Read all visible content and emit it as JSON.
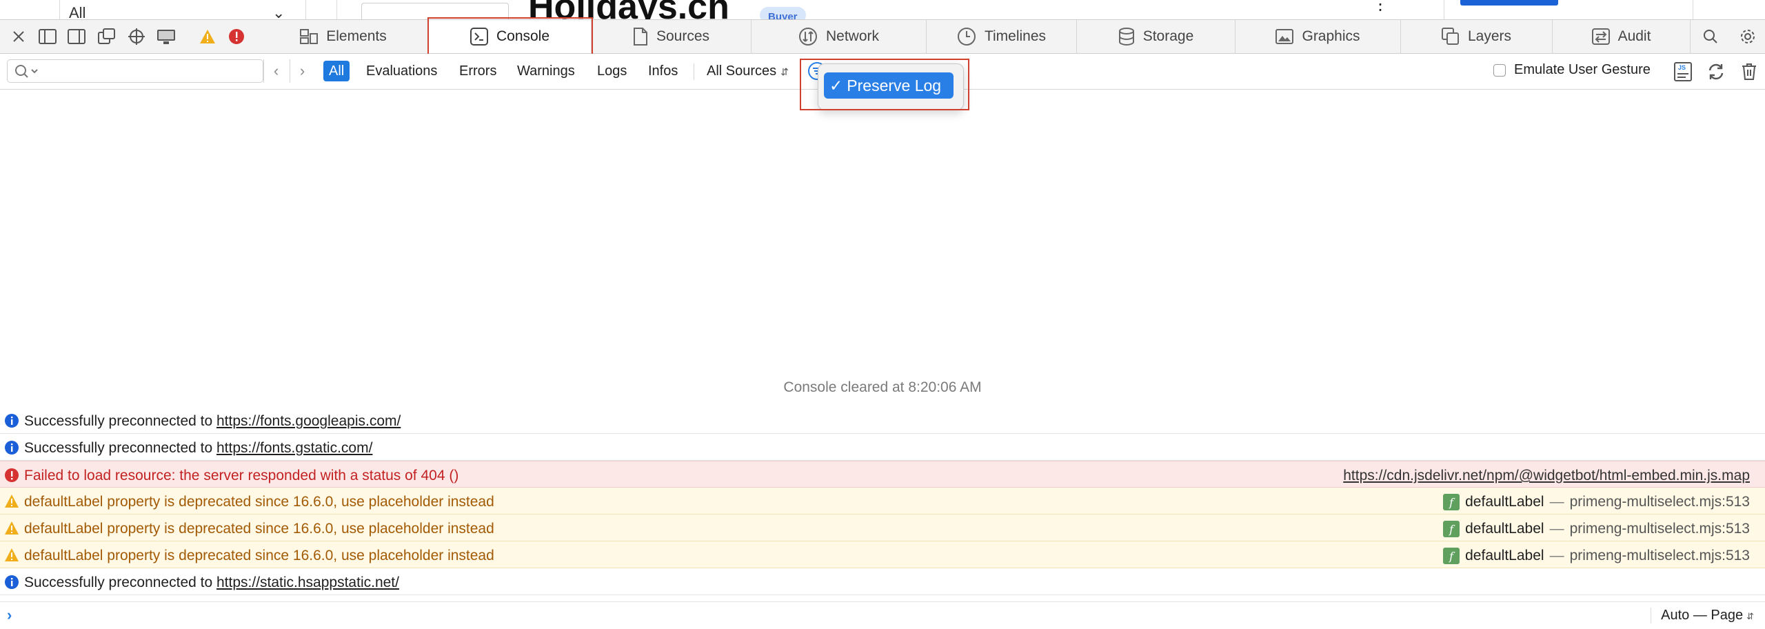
{
  "page": {
    "all_filter": "All",
    "title": "Holidays.ch",
    "badge": "Buyer"
  },
  "toolbar": {
    "tabs": [
      {
        "label": "Elements",
        "icon": "elements-icon"
      },
      {
        "label": "Console",
        "icon": "console-icon",
        "active": true
      },
      {
        "label": "Sources",
        "icon": "sources-icon"
      },
      {
        "label": "Network",
        "icon": "network-icon"
      },
      {
        "label": "Timelines",
        "icon": "timelines-icon"
      },
      {
        "label": "Storage",
        "icon": "storage-icon"
      },
      {
        "label": "Graphics",
        "icon": "graphics-icon"
      },
      {
        "label": "Layers",
        "icon": "layers-icon"
      },
      {
        "label": "Audit",
        "icon": "audit-icon"
      }
    ]
  },
  "filterbar": {
    "search_placeholder": "",
    "levels": [
      "All",
      "Evaluations",
      "Errors",
      "Warnings",
      "Logs",
      "Infos"
    ],
    "active_level": "All",
    "sources": "All Sources",
    "emulate_label": "Emulate User Gesture",
    "emulate_checked": false
  },
  "popup": {
    "option": "Preserve Log",
    "checked": true
  },
  "console": {
    "cleared": "Console cleared at 8:20:06 AM",
    "messages": [
      {
        "level": "info",
        "text": "Successfully preconnected to ",
        "link": "https://fonts.googleapis.com/"
      },
      {
        "level": "info",
        "text": "Successfully preconnected to ",
        "link": "https://fonts.gstatic.com/"
      },
      {
        "level": "error",
        "text": "Failed to load resource: the server responded with a status of 404 ()",
        "source": "https://cdn.jsdelivr.net/npm/@widgetbot/html-embed.min.js.map"
      },
      {
        "level": "warning",
        "text": "defaultLabel property is deprecated since 16.6.0, use placeholder instead",
        "fn": "defaultLabel",
        "dash": "—",
        "file": "primeng-multiselect.mjs:513"
      },
      {
        "level": "warning",
        "text": "defaultLabel property is deprecated since 16.6.0, use placeholder instead",
        "fn": "defaultLabel",
        "dash": "—",
        "file": "primeng-multiselect.mjs:513"
      },
      {
        "level": "warning",
        "text": "defaultLabel property is deprecated since 16.6.0, use placeholder instead",
        "fn": "defaultLabel",
        "dash": "—",
        "file": "primeng-multiselect.mjs:513"
      },
      {
        "level": "info",
        "text": "Successfully preconnected to ",
        "link": "https://static.hsappstatic.net/"
      }
    ]
  },
  "prompt": {
    "context": "Auto — Page"
  },
  "colors": {
    "accent": "#2a7fe6",
    "error": "#c22222",
    "warning": "#a35a05",
    "highlight_box": "#d0402e"
  }
}
